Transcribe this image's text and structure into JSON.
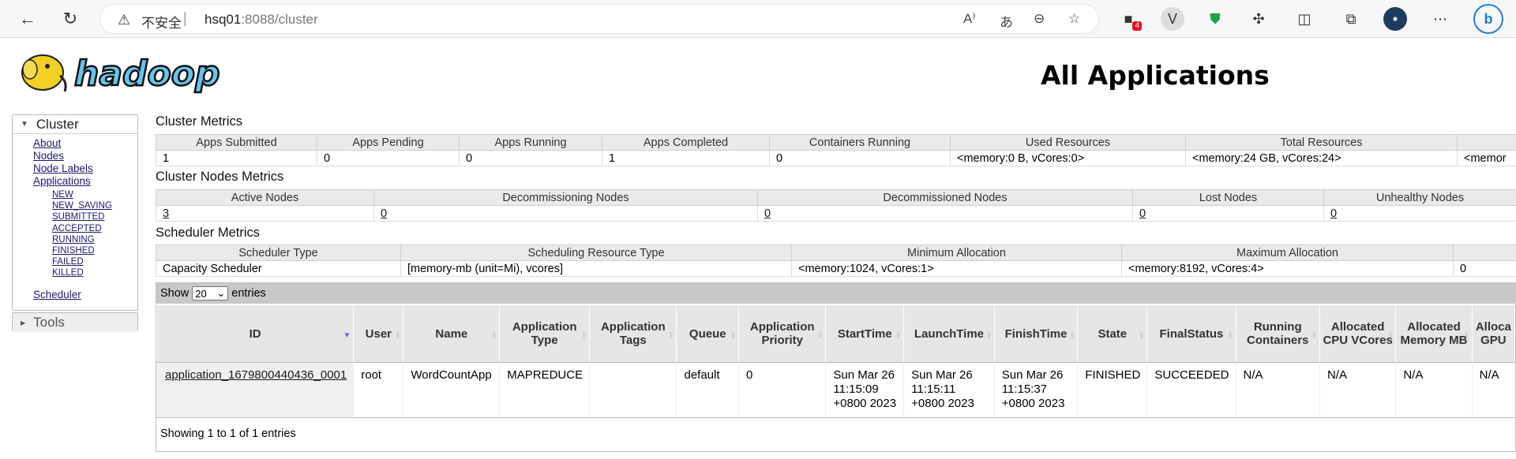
{
  "browser": {
    "insecure_label": "不安全",
    "url_host": "hsq01",
    "url_port": ":8088",
    "url_path": "/cluster",
    "ext_badge": "4"
  },
  "page": {
    "title": "All Applications",
    "logo_text": "hadoop"
  },
  "sidebar": {
    "cluster_label": "Cluster",
    "links": [
      "About",
      "Nodes",
      "Node Labels",
      "Applications"
    ],
    "app_states": [
      "NEW",
      "NEW_SAVING",
      "SUBMITTED",
      "ACCEPTED",
      "RUNNING",
      "FINISHED",
      "FAILED",
      "KILLED"
    ],
    "scheduler": "Scheduler",
    "tools_label": "Tools"
  },
  "cluster_metrics": {
    "title": "Cluster Metrics",
    "headers": [
      "Apps Submitted",
      "Apps Pending",
      "Apps Running",
      "Apps Completed",
      "Containers Running",
      "Used Resources",
      "Total Resources",
      ""
    ],
    "values": [
      "1",
      "0",
      "0",
      "1",
      "0",
      "<memory:0 B, vCores:0>",
      "<memory:24 GB, vCores:24>",
      "<memor"
    ]
  },
  "nodes_metrics": {
    "title": "Cluster Nodes Metrics",
    "headers": [
      "Active Nodes",
      "Decommissioning Nodes",
      "Decommissioned Nodes",
      "Lost Nodes",
      "Unhealthy Nodes"
    ],
    "values": [
      "3",
      "0",
      "0",
      "0",
      "0"
    ]
  },
  "scheduler_metrics": {
    "title": "Scheduler Metrics",
    "headers": [
      "Scheduler Type",
      "Scheduling Resource Type",
      "Minimum Allocation",
      "Maximum Allocation",
      ""
    ],
    "values": [
      "Capacity Scheduler",
      "[memory-mb (unit=Mi), vcores]",
      "<memory:1024, vCores:1>",
      "<memory:8192, vCores:4>",
      "0"
    ]
  },
  "apps": {
    "show_label": "Show",
    "entries_label": "entries",
    "page_size": "20",
    "headers": [
      "ID",
      "User",
      "Name",
      "Application Type",
      "Application Tags",
      "Queue",
      "Application Priority",
      "StartTime",
      "LaunchTime",
      "FinishTime",
      "State",
      "FinalStatus",
      "Running Containers",
      "Allocated CPU VCores",
      "Allocated Memory MB",
      "Alloca GPU"
    ],
    "rows": [
      {
        "id": "application_1679800440436_0001",
        "user": "root",
        "name": "WordCountApp",
        "type": "MAPREDUCE",
        "tags": "",
        "queue": "default",
        "priority": "0",
        "start": [
          "Sun Mar 26",
          "11:15:09",
          "+0800 2023"
        ],
        "launch": [
          "Sun Mar 26",
          "11:15:11",
          "+0800 2023"
        ],
        "finish": [
          "Sun Mar 26",
          "11:15:37",
          "+0800 2023"
        ],
        "state": "FINISHED",
        "final_status": "SUCCEEDED",
        "running_containers": "N/A",
        "alloc_vcores": "N/A",
        "alloc_mem": "N/A",
        "alloc_gpu": "N/A"
      }
    ],
    "footer": "Showing 1 to 1 of 1 entries"
  }
}
